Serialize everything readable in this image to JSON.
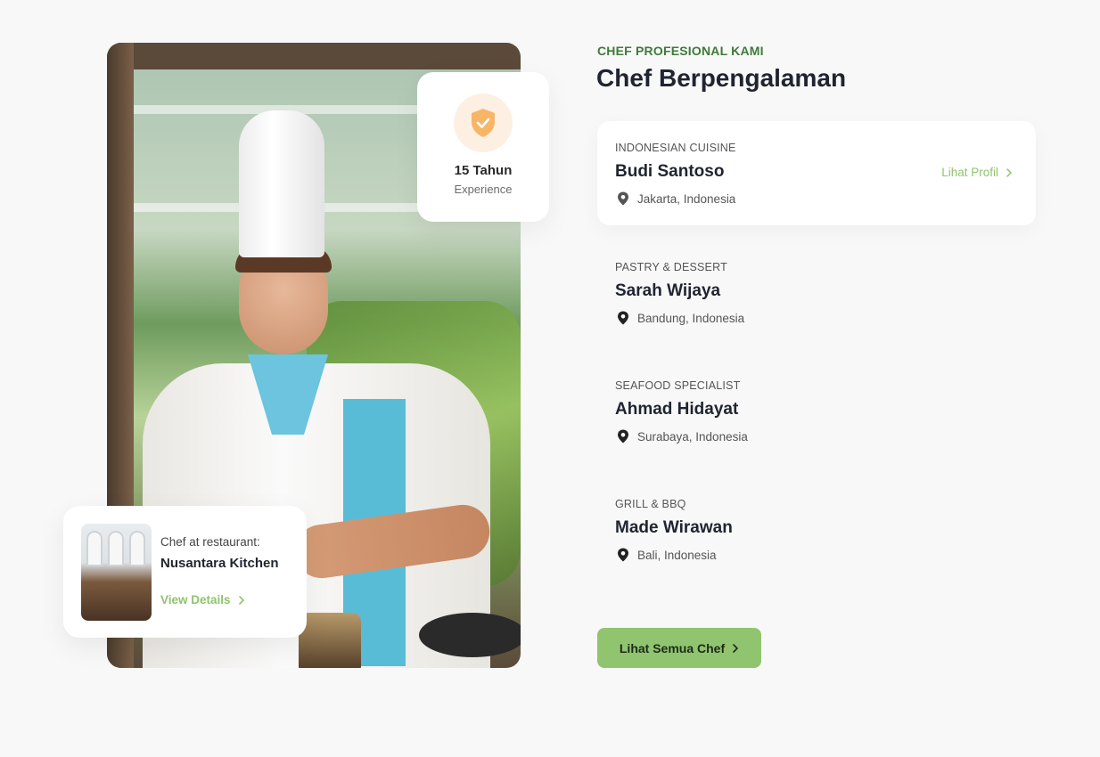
{
  "header": {
    "eyebrow": "CHEF PROFESIONAL KAMI",
    "title": "Chef Berpengalaman"
  },
  "experience_badge": {
    "icon": "shield-check-icon",
    "years": "15 Tahun",
    "label": "Experience",
    "icon_color": "#f7b667",
    "icon_bg": "#fdf0e3"
  },
  "restaurant_card": {
    "subtitle": "Chef at restaurant:",
    "name": "Nusantara Kitchen",
    "link_label": "View Details",
    "link_icon": "chevron-right-icon"
  },
  "chefs": [
    {
      "specialty": "INDONESIAN CUISINE",
      "name": "Budi Santoso",
      "location": "Jakarta, Indonesia",
      "active": true,
      "profile_link": "Lihat Profil"
    },
    {
      "specialty": "PASTRY & DESSERT",
      "name": "Sarah Wijaya",
      "location": "Bandung, Indonesia",
      "active": false
    },
    {
      "specialty": "SEAFOOD SPECIALIST",
      "name": "Ahmad Hidayat",
      "location": "Surabaya, Indonesia",
      "active": false
    },
    {
      "specialty": "GRILL & BBQ",
      "name": "Made Wirawan",
      "location": "Bali, Indonesia",
      "active": false
    }
  ],
  "cta": {
    "label": "Lihat Semua Chef",
    "icon": "chevron-right-icon"
  },
  "colors": {
    "accent_green": "#90c46f",
    "eyebrow_green": "#3f7a3a",
    "title_dark": "#1f2430",
    "background": "#f8f8f8"
  }
}
